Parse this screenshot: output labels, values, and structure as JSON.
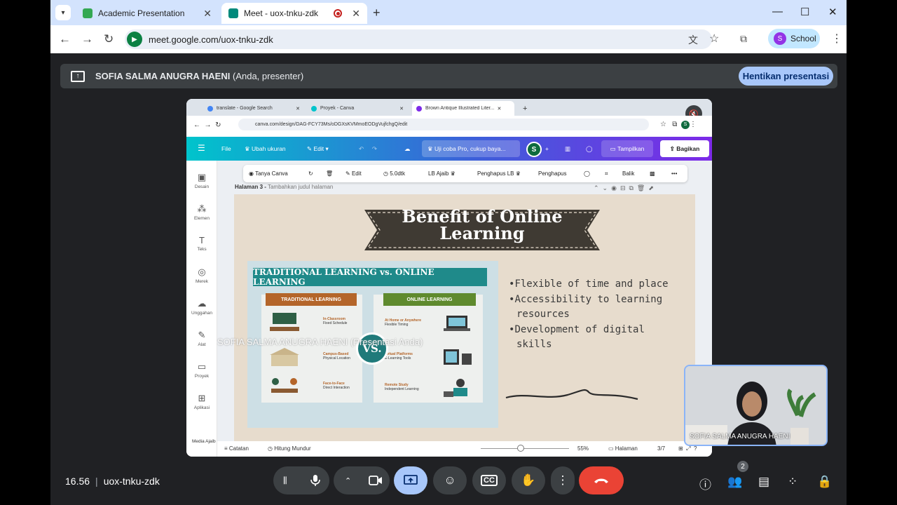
{
  "browser": {
    "tabs": [
      {
        "title": "Academic Presentation"
      },
      {
        "title": "Meet - uox-tnku-zdk"
      }
    ],
    "url": "meet.google.com/uox-tnku-zdk",
    "profile_label": "School",
    "profile_initial": "S"
  },
  "meet": {
    "banner_title": "SOFIA SALMA ANUGRA HAENI",
    "banner_suffix": "(Anda, presenter)",
    "stop_button": "Hentikan presentasi",
    "time": "16.56",
    "meeting_code": "uox-tnku-zdk",
    "participants_count": "2",
    "self_name": "SOFIA SALMA ANUGRA HAENI",
    "overlay_name": "SOFIA SALMA ANUGRA HAENI (Presentasi Anda)"
  },
  "shared": {
    "tabs": [
      {
        "title": "translate - Google Search"
      },
      {
        "title": "Proyek - Canva"
      },
      {
        "title": "Brown Antique Illustrated Liter..."
      }
    ],
    "url": "canva.com/design/DAG-FCY73Ms/oDGXsKVMmoEODgVujfchgQ/edit",
    "topbar": {
      "file": "File",
      "resize": "Ubah ukuran",
      "edit": "Edit",
      "trial": "Uji coba Pro, cukup baya...",
      "avatar": "S",
      "present": "Tampilkan",
      "share": "Bagikan"
    },
    "sidebar": [
      "Desain",
      "Elemen",
      "Teks",
      "Merek",
      "Unggahan",
      "Alat",
      "Proyek",
      "Aplikasi"
    ],
    "toolbar": {
      "ask": "Tanya Canva",
      "edit": "Edit",
      "duration": "5.0dtk",
      "magic_bg": "LB Ajaib",
      "bg_remover": "Penghapus LB",
      "eraser": "Penghapus",
      "flip": "Balik"
    },
    "page_label": "Halaman 3 -",
    "page_hint": "Tambahkan judul halaman",
    "bottom": {
      "magic_media": "Media Ajaib",
      "notes": "Catatan",
      "timer": "Hitung Mundur",
      "zoom": "55%",
      "pages": "Halaman",
      "page_count": "3/7"
    }
  },
  "slide": {
    "title_line1": "Benefit of Online",
    "title_line2": "Learning",
    "infographic": {
      "banner": "TRADITIONAL LEARNING vs. ONLINE LEARNING",
      "left_header": "TRADITIONAL LEARNING",
      "right_header": "ONLINE LEARNING",
      "vs": "VS.",
      "left_rows": [
        {
          "title": "In-Classroom",
          "sub": "Fixed Schedule"
        },
        {
          "title": "Campus-Based",
          "sub": "Physical Location"
        },
        {
          "title": "Face-to-Face",
          "sub": "Direct Interaction"
        }
      ],
      "right_rows": [
        {
          "title": "At Home or Anywhere",
          "sub": "Flexible Timing"
        },
        {
          "title": "Virtual Platforms",
          "sub": "E-Learning Tools"
        },
        {
          "title": "Remote Study",
          "sub": "Independent Learning"
        }
      ]
    },
    "bullets": [
      "Flexible of time and place",
      "Accessibility to learning resources",
      "Development of digital skills"
    ]
  },
  "colors": {
    "meet_bg": "#202124",
    "stop_button_bg": "#a8c7fa",
    "end_call": "#ea4335",
    "present_active": "#a8c7fa",
    "canva_teal": "#00c4cc",
    "canva_purple": "#7d2ae8",
    "infographic_teal": "#1f8a8a"
  }
}
